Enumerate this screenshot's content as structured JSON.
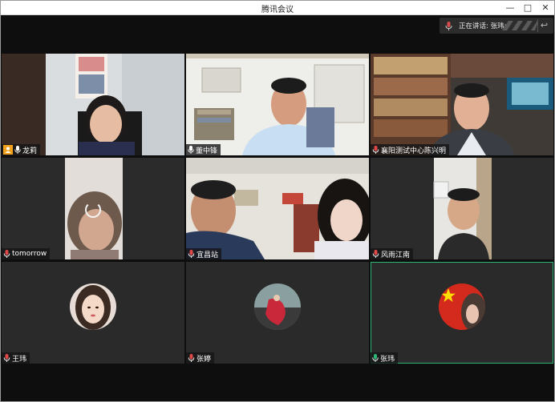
{
  "window": {
    "title": "腾讯会议"
  },
  "speaking": {
    "label": "正在讲话: 张玮;"
  },
  "participants": [
    {
      "name": "龙莉",
      "host": true,
      "muted": false
    },
    {
      "name": "董中锋",
      "host": false,
      "muted": false
    },
    {
      "name": "襄阳测试中心陈兴明",
      "host": false,
      "muted": true
    },
    {
      "name": "tomorrow",
      "host": false,
      "muted": true
    },
    {
      "name": "宜昌站",
      "host": false,
      "muted": true
    },
    {
      "name": "风雨江南",
      "host": false,
      "muted": true
    },
    {
      "name": "王玮",
      "host": false,
      "muted": true
    },
    {
      "name": "张婷",
      "host": false,
      "muted": true
    },
    {
      "name": "张玮",
      "host": false,
      "muted": false,
      "speaking": true
    }
  ],
  "colors": {
    "speaking_border": "#2bb673",
    "host_badge": "#f0a01a",
    "mic_on": "#2bb673",
    "mic_muted": "#e04848"
  },
  "icons": [
    "minimize-icon",
    "maximize-icon",
    "close-icon",
    "microphone-icon",
    "microphone-muted-icon",
    "user-icon",
    "undo-icon",
    "loading-spinner-icon"
  ]
}
